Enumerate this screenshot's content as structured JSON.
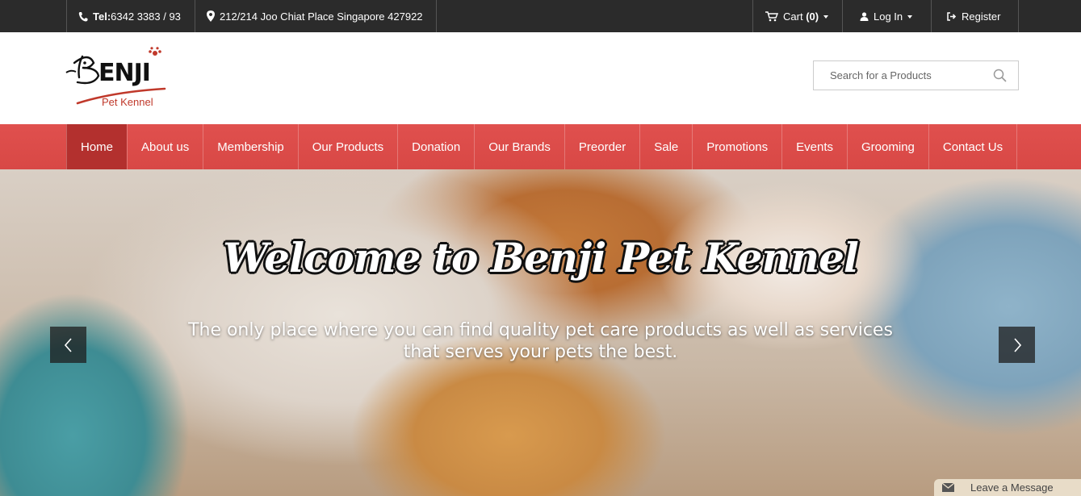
{
  "topbar": {
    "tel_label": "Tel:",
    "tel_number": "6342 3383 / 93",
    "address": "212/214 Joo Chiat Place Singapore 427922",
    "cart_label": "Cart",
    "cart_count": "(0)",
    "login_label": "Log In",
    "register_label": "Register"
  },
  "header": {
    "logo_text": "ENJI",
    "logo_sub": "Pet Kennel",
    "search_placeholder": "Search for a Products"
  },
  "nav": {
    "items": [
      {
        "label": "Home"
      },
      {
        "label": "About us"
      },
      {
        "label": "Membership"
      },
      {
        "label": "Our Products"
      },
      {
        "label": "Donation"
      },
      {
        "label": "Our Brands"
      },
      {
        "label": "Preorder"
      },
      {
        "label": "Sale"
      },
      {
        "label": "Promotions"
      },
      {
        "label": "Events"
      },
      {
        "label": "Grooming"
      },
      {
        "label": "Contact Us"
      }
    ]
  },
  "hero": {
    "title": "Welcome to Benji Pet Kennel",
    "subtitle_line1": "The only place where you can find quality pet care products as well as services",
    "subtitle_line2": "that serves your pets the best."
  },
  "chat": {
    "label": "Leave a Message"
  },
  "colors": {
    "topbar_bg": "#2b2b2b",
    "nav_bg": "#d84845",
    "nav_active": "#b3302e",
    "brand_red": "#c0392b"
  }
}
